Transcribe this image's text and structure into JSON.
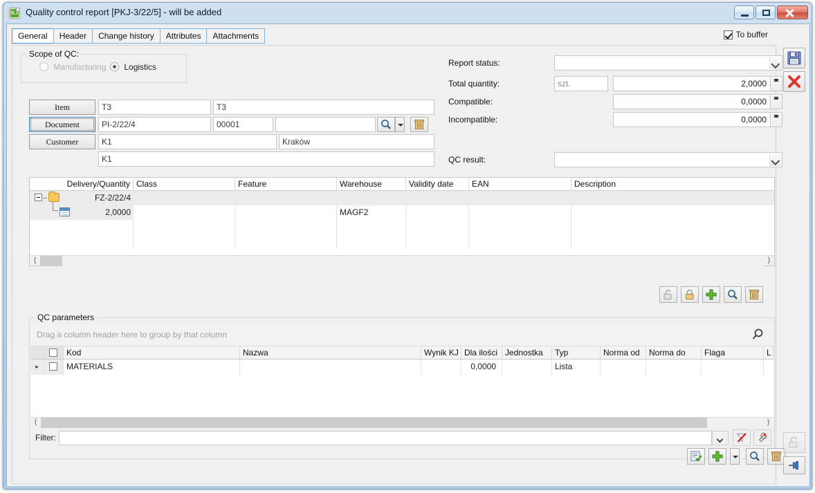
{
  "window": {
    "title": "Quality control report [PKJ-3/22/5] - will be added",
    "app_icon": "kj-app-icon",
    "minimize_label": "",
    "maximize_label": "",
    "close_label": ""
  },
  "tabs": [
    {
      "label": "General",
      "active": true
    },
    {
      "label": "Header",
      "active": false
    },
    {
      "label": "Change history",
      "active": false
    },
    {
      "label": "Attributes",
      "active": false
    },
    {
      "label": "Attachments",
      "active": false
    }
  ],
  "to_buffer": {
    "label": "To buffer",
    "checked": true
  },
  "scope": {
    "legend": "Scope of QC:",
    "manufacturing": {
      "label": "Manufacturing",
      "selected": false,
      "disabled": true
    },
    "logistics": {
      "label": "Logistics",
      "selected": true,
      "disabled": false
    }
  },
  "left_form": {
    "item_button": "Item",
    "item_code": "T3",
    "item_name": "T3",
    "document_button": "Document",
    "document_code": "PI-2/22/4",
    "document_number": "00001",
    "document_extra": "",
    "customer_button": "Customer",
    "customer_code": "K1",
    "customer_city": "Kraków",
    "customer_name": "K1"
  },
  "right_form": {
    "report_status_label": "Report status:",
    "report_status_value": "",
    "total_quantity_label": "Total quantity:",
    "unit": "szt.",
    "total_quantity_value": "2,0000",
    "compatible_label": "Compatible:",
    "compatible_value": "0,0000",
    "incompatible_label": "Incompatible:",
    "incompatible_value": "0,0000",
    "qc_result_label": "QC result:",
    "qc_result_value": ""
  },
  "delivery_grid": {
    "columns": [
      "Delivery/Quantity",
      "Class",
      "Feature",
      "Warehouse",
      "Validity date",
      "EAN",
      "Description"
    ],
    "rows": [
      {
        "type": "group",
        "icon": "folder-icon",
        "delivery": "FZ-2/22/4",
        "class": "",
        "feature": "",
        "warehouse": "",
        "validity": "",
        "ean": "",
        "description": ""
      },
      {
        "type": "child",
        "icon": "document-icon",
        "delivery": "2,0000",
        "class": "",
        "feature": "",
        "warehouse": "MAGF2",
        "validity": "",
        "ean": "",
        "description": ""
      }
    ]
  },
  "delivery_toolbar": [
    {
      "name": "unlock-icon",
      "title": "",
      "disabled": true
    },
    {
      "name": "lock-icon",
      "title": "",
      "disabled": false
    },
    {
      "name": "plus-icon",
      "title": "",
      "disabled": false
    },
    {
      "name": "magnifier-icon",
      "title": "",
      "disabled": false
    },
    {
      "name": "trash-icon",
      "title": "",
      "disabled": false
    }
  ],
  "qc_parameters": {
    "legend": "QC parameters",
    "group_hint": "Drag a column header here to group by that column",
    "columns": [
      "",
      "",
      "Kod",
      "Nazwa",
      "Wynik KJ",
      "Dla ilości",
      "Jednostka",
      "Typ",
      "Norma od",
      "Norma do",
      "Flaga",
      "L"
    ],
    "rows": [
      {
        "marker": "▸",
        "checked": false,
        "kod": "MATERIALS",
        "nazwa": "",
        "wynik_kj": "",
        "dla_ilosci": "0,0000",
        "jednostka": "",
        "typ": "Lista",
        "norma_od": "",
        "norma_do": "",
        "flaga": "",
        "l": ""
      }
    ]
  },
  "filter": {
    "label": "Filter:",
    "value": "",
    "dropdown_icon": "chevron-down-icon",
    "clear_filter_icon": "clear-filter-icon",
    "filter_builder_icon": "filter-builder-icon"
  },
  "bottom_toolbar": [
    {
      "name": "edit-list-icon"
    },
    {
      "name": "plus-icon"
    },
    {
      "name": "dropdown-arrow-icon"
    },
    {
      "name": "magnifier-icon"
    },
    {
      "name": "trash-icon"
    }
  ],
  "side_toolbar": [
    {
      "name": "save-icon"
    },
    {
      "name": "cancel-icon"
    }
  ],
  "side_toolbar_bottom": [
    {
      "name": "unlock-icon"
    },
    {
      "name": "pin-icon"
    }
  ],
  "colors": {
    "accent": "#4a90d9",
    "title_gradient_top": "#cfe0f0",
    "close_red": "#cd4f3d",
    "green": "#4faa1e",
    "folder_yellow": "#f6c85c"
  }
}
